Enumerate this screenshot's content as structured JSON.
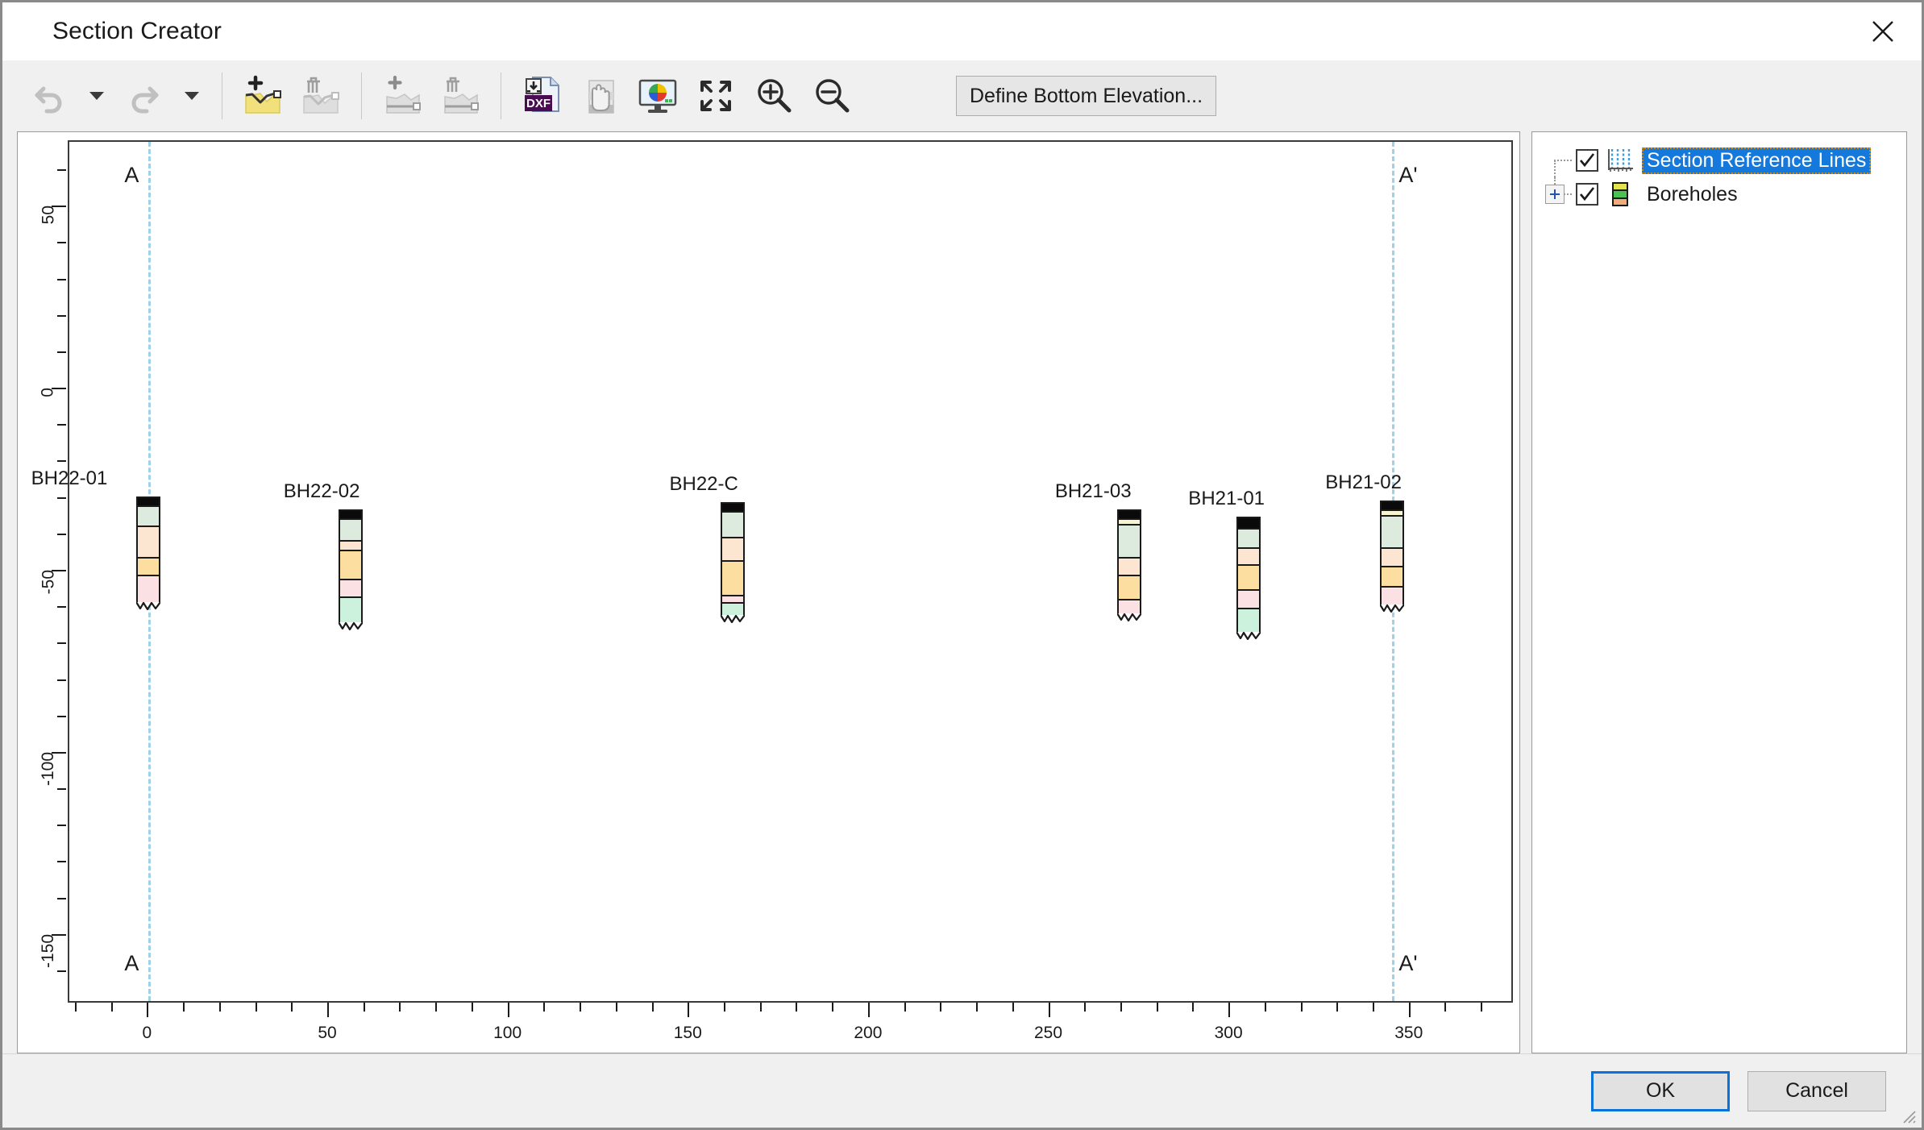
{
  "window": {
    "title": "Section Creator",
    "close_icon": "close-icon"
  },
  "toolbar": {
    "items": [
      {
        "name": "undo-button",
        "icon": "undo-arrow-icon",
        "label": "Undo",
        "enabled": false
      },
      {
        "name": "undo-dropdown",
        "icon": "chevron-down-icon",
        "label": "Undo history",
        "enabled": false
      },
      {
        "name": "redo-button",
        "icon": "redo-arrow-icon",
        "label": "Redo",
        "enabled": false
      },
      {
        "name": "redo-dropdown",
        "icon": "chevron-down-icon",
        "label": "Redo history",
        "enabled": false
      },
      {
        "name": "add-layer-button",
        "icon": "add-layer-icon",
        "label": "Add Layer",
        "enabled": true
      },
      {
        "name": "delete-layer-button",
        "icon": "delete-layer-icon",
        "label": "Delete Layer",
        "enabled": false
      },
      {
        "name": "add-bottom-line-button",
        "icon": "add-bottom-line-icon",
        "label": "Add Bottom Line",
        "enabled": false
      },
      {
        "name": "delete-bottom-line-button",
        "icon": "delete-bottom-line-icon",
        "label": "Delete Bottom Line",
        "enabled": false
      },
      {
        "name": "export-dxf-button",
        "icon": "dxf-export-icon",
        "label": "Export DXF",
        "enabled": true
      },
      {
        "name": "pan-button",
        "icon": "hand-pan-icon",
        "label": "Pan",
        "enabled": true
      },
      {
        "name": "display-options-button",
        "icon": "display-color-icon",
        "label": "Display Options",
        "enabled": true
      },
      {
        "name": "zoom-extents-button",
        "icon": "zoom-extents-icon",
        "label": "Zoom Extents",
        "enabled": true
      },
      {
        "name": "zoom-in-button",
        "icon": "zoom-in-icon",
        "label": "Zoom In",
        "enabled": true
      },
      {
        "name": "zoom-out-button",
        "icon": "zoom-out-icon",
        "label": "Zoom Out",
        "enabled": true
      }
    ],
    "define_bottom_elevation_label": "Define Bottom Elevation..."
  },
  "tree": {
    "items": [
      {
        "label": "Section Reference Lines",
        "checked": true,
        "selected": true,
        "expandable": false,
        "icon": "section-lines-icon"
      },
      {
        "label": "Boreholes",
        "checked": true,
        "selected": false,
        "expandable": true,
        "icon": "borehole-stack-icon"
      }
    ]
  },
  "footer": {
    "ok_label": "OK",
    "cancel_label": "Cancel"
  },
  "chart_data": {
    "type": "scatter",
    "title": "",
    "xlabel": "",
    "ylabel": "",
    "xlim": [
      -22,
      378
    ],
    "ylim": [
      -168,
      68
    ],
    "xticks": [
      0,
      50,
      100,
      150,
      200,
      250,
      300,
      350
    ],
    "yticks": [
      50,
      0,
      -50,
      -100,
      -150
    ],
    "xtick_labels": [
      "0",
      "50",
      "100",
      "150",
      "200",
      "250",
      "300",
      "350"
    ],
    "ytick_labels": [
      "50",
      "0",
      "-50",
      "-100",
      "-150"
    ],
    "grid": false,
    "legend": "none",
    "section_reference_lines": [
      {
        "label": "A",
        "x": 0,
        "label_side": "left",
        "color": "#9fd2e8"
      },
      {
        "label": "A'",
        "x": 345,
        "label_side": "right",
        "color": "#9fd2e8"
      }
    ],
    "layer_colors": {
      "topsoil": "#0a0a0a",
      "fill": "#f7f5cf",
      "pale_green": "#dcebdd",
      "peach": "#fce6d2",
      "yellow": "#fcdfa0",
      "pink": "#fbe0e4",
      "mint": "#ccf2dd"
    },
    "boreholes": [
      {
        "name": "BH22-01",
        "x": 0,
        "top": -29.5,
        "bottom": -58.5,
        "label_x": -22,
        "layers": [
          {
            "color": "#0a0a0a",
            "from": -29.5,
            "to": -31.5
          },
          {
            "color": "#dcebdd",
            "from": -31.5,
            "to": -37.0
          },
          {
            "color": "#fce6d2",
            "from": -37.0,
            "to": -45.5
          },
          {
            "color": "#fcdfa0",
            "from": -45.5,
            "to": -50.5
          },
          {
            "color": "#fbe0e4",
            "from": -50.5,
            "to": -58.5
          }
        ]
      },
      {
        "name": "BH22-02",
        "x": 56,
        "top": -33.0,
        "bottom": -64.0,
        "label_x": 48,
        "layers": [
          {
            "color": "#0a0a0a",
            "from": -33.0,
            "to": -35.0
          },
          {
            "color": "#dcebdd",
            "from": -35.0,
            "to": -41.0
          },
          {
            "color": "#fce6d2",
            "from": -41.0,
            "to": -43.5
          },
          {
            "color": "#fcdfa0",
            "from": -43.5,
            "to": -51.5
          },
          {
            "color": "#fbe0e4",
            "from": -51.5,
            "to": -56.5
          },
          {
            "color": "#ccf2dd",
            "from": -56.5,
            "to": -64.0
          }
        ]
      },
      {
        "name": "BH22-C",
        "x": 162,
        "top": -31.0,
        "bottom": -62.0,
        "label_x": 154,
        "layers": [
          {
            "color": "#0a0a0a",
            "from": -31.0,
            "to": -33.0
          },
          {
            "color": "#dcebdd",
            "from": -33.0,
            "to": -40.0
          },
          {
            "color": "#fce6d2",
            "from": -40.0,
            "to": -46.5
          },
          {
            "color": "#fcdfa0",
            "from": -46.5,
            "to": -56.0
          },
          {
            "color": "#fbe0e4",
            "from": -56.0,
            "to": -58.0
          },
          {
            "color": "#ccf2dd",
            "from": -58.0,
            "to": -62.0
          }
        ]
      },
      {
        "name": "BH21-03",
        "x": 272,
        "top": -33.0,
        "bottom": -61.5,
        "label_x": 262,
        "layers": [
          {
            "color": "#0a0a0a",
            "from": -33.0,
            "to": -35.0
          },
          {
            "color": "#f7f5cf",
            "from": -35.0,
            "to": -36.5
          },
          {
            "color": "#dcebdd",
            "from": -36.5,
            "to": -45.5
          },
          {
            "color": "#fce6d2",
            "from": -45.5,
            "to": -50.5
          },
          {
            "color": "#fcdfa0",
            "from": -50.5,
            "to": -57.0
          },
          {
            "color": "#fbe0e4",
            "from": -57.0,
            "to": -61.5
          }
        ]
      },
      {
        "name": "BH21-01",
        "x": 305,
        "top": -35.0,
        "bottom": -66.5,
        "label_x": 299,
        "layers": [
          {
            "color": "#0a0a0a",
            "from": -35.0,
            "to": -37.5
          },
          {
            "color": "#dcebdd",
            "from": -37.5,
            "to": -43.0
          },
          {
            "color": "#fce6d2",
            "from": -43.0,
            "to": -47.5
          },
          {
            "color": "#fcdfa0",
            "from": -47.5,
            "to": -54.5
          },
          {
            "color": "#fbe0e4",
            "from": -54.5,
            "to": -59.5
          },
          {
            "color": "#ccf2dd",
            "from": -59.5,
            "to": -66.5
          }
        ]
      },
      {
        "name": "BH21-02",
        "x": 345,
        "top": -30.5,
        "bottom": -59.0,
        "label_x": 337,
        "layers": [
          {
            "color": "#0a0a0a",
            "from": -30.5,
            "to": -32.5
          },
          {
            "color": "#f7f5cf",
            "from": -32.5,
            "to": -34.0
          },
          {
            "color": "#dcebdd",
            "from": -34.0,
            "to": -43.0
          },
          {
            "color": "#fce6d2",
            "from": -43.0,
            "to": -48.0
          },
          {
            "color": "#fcdfa0",
            "from": -48.0,
            "to": -53.5
          },
          {
            "color": "#fbe0e4",
            "from": -53.5,
            "to": -59.0
          }
        ]
      }
    ]
  }
}
